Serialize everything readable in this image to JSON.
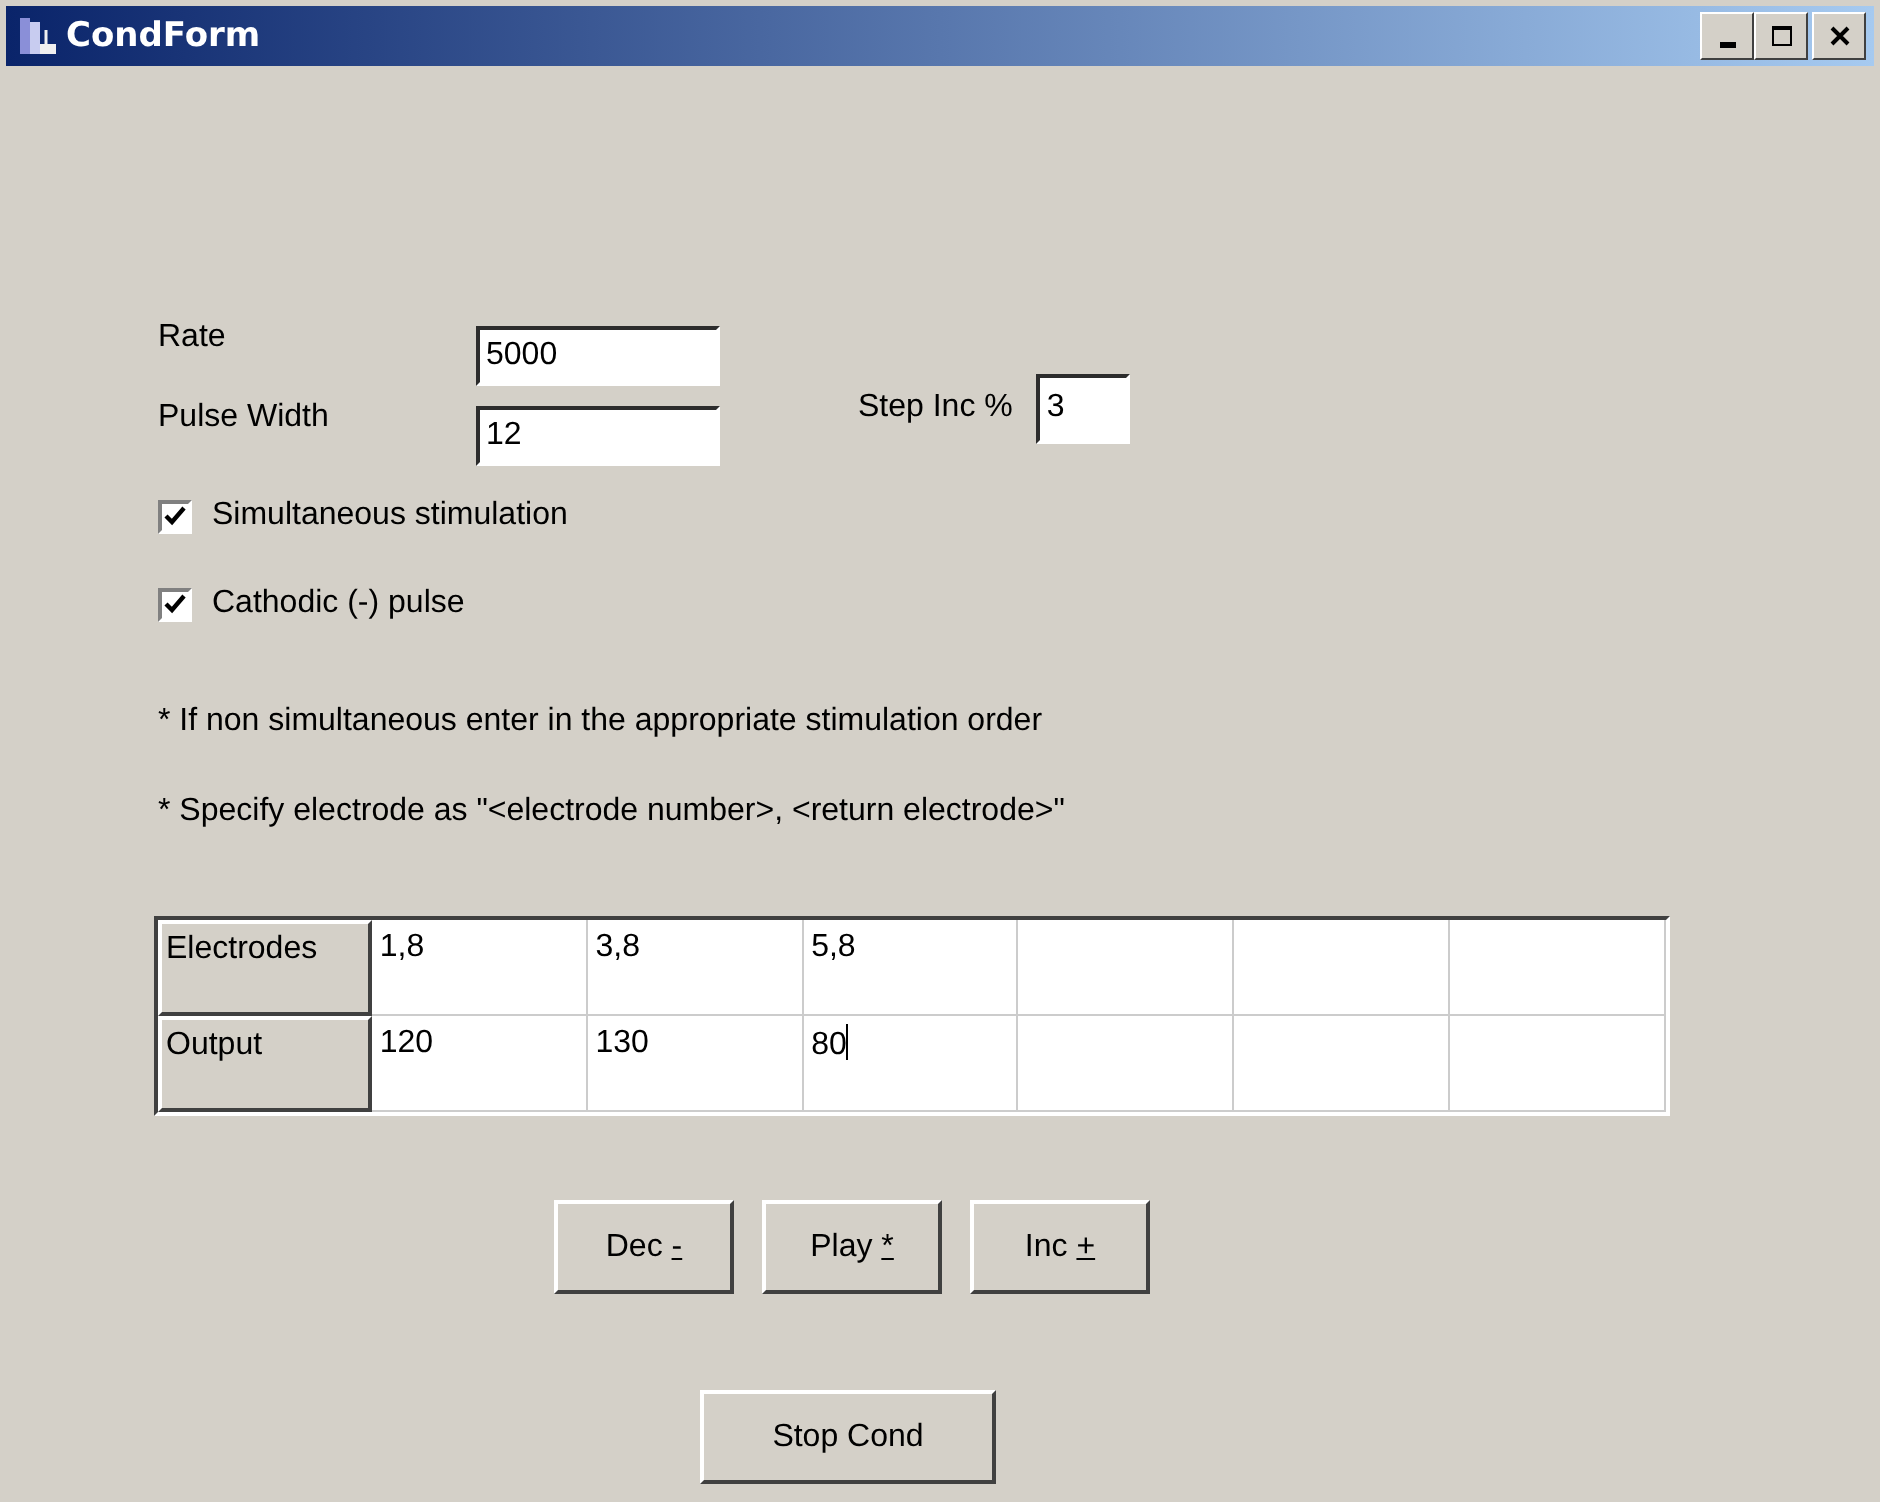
{
  "window": {
    "title": "CondForm"
  },
  "fields": [
    {
      "label": "Rate",
      "value": "5000"
    },
    {
      "label": "Pulse Width",
      "value": "12"
    }
  ],
  "step_inc": {
    "label": "Step Inc %",
    "value": "3"
  },
  "checkboxes": [
    {
      "label": "Simultaneous stimulation",
      "checked": true
    },
    {
      "label": "Cathodic (-) pulse",
      "checked": true
    }
  ],
  "notes": [
    "* If non simultaneous enter in the appropriate stimulation order",
    "* Specify electrode as \"<electrode number>, <return electrode>\""
  ],
  "grid": {
    "rows": [
      {
        "header": "Electrodes",
        "cells": [
          {
            "kind": "text",
            "value": "1,8",
            "editing": false
          },
          {
            "kind": "text",
            "value": "3,8",
            "editing": false
          },
          {
            "kind": "text",
            "value": "5,8",
            "editing": false
          },
          {
            "kind": "empty",
            "editing": false
          },
          {
            "kind": "empty",
            "editing": false
          },
          {
            "kind": "empty",
            "editing": false
          }
        ]
      },
      {
        "header": "Output",
        "cells": [
          {
            "kind": "text",
            "value": "120",
            "editing": false
          },
          {
            "kind": "text",
            "value": "130",
            "editing": false
          },
          {
            "kind": "text",
            "value": "80",
            "editing": true
          },
          {
            "kind": "empty",
            "editing": false
          },
          {
            "kind": "empty",
            "editing": false
          },
          {
            "kind": "empty",
            "editing": false
          }
        ]
      }
    ]
  },
  "buttons": [
    {
      "label": "Dec",
      "key": "-"
    },
    {
      "label": "Play",
      "key": "*"
    },
    {
      "label": "Inc",
      "key": "+"
    }
  ],
  "stop_button": {
    "label": "Stop Cond"
  }
}
